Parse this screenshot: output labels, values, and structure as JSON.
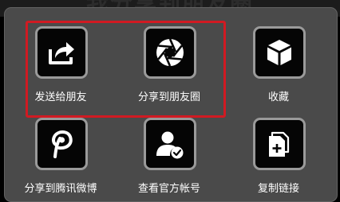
{
  "header": {
    "title": "我分享到朋友圈"
  },
  "menu": {
    "items": [
      {
        "label": "发送给朋友",
        "icon": "share-forward-icon"
      },
      {
        "label": "分享到朋友圈",
        "icon": "camera-aperture-icon"
      },
      {
        "label": "收藏",
        "icon": "cube-icon"
      },
      {
        "label": "分享到腾讯微博",
        "icon": "tencent-weibo-icon"
      },
      {
        "label": "查看官方帐号",
        "icon": "verified-account-icon"
      },
      {
        "label": "复制链接",
        "icon": "copy-document-icon"
      }
    ]
  },
  "colors": {
    "highlight": "#d11a22",
    "sheet": "#4a4a4a",
    "tile_border": "#9a9a9a"
  }
}
